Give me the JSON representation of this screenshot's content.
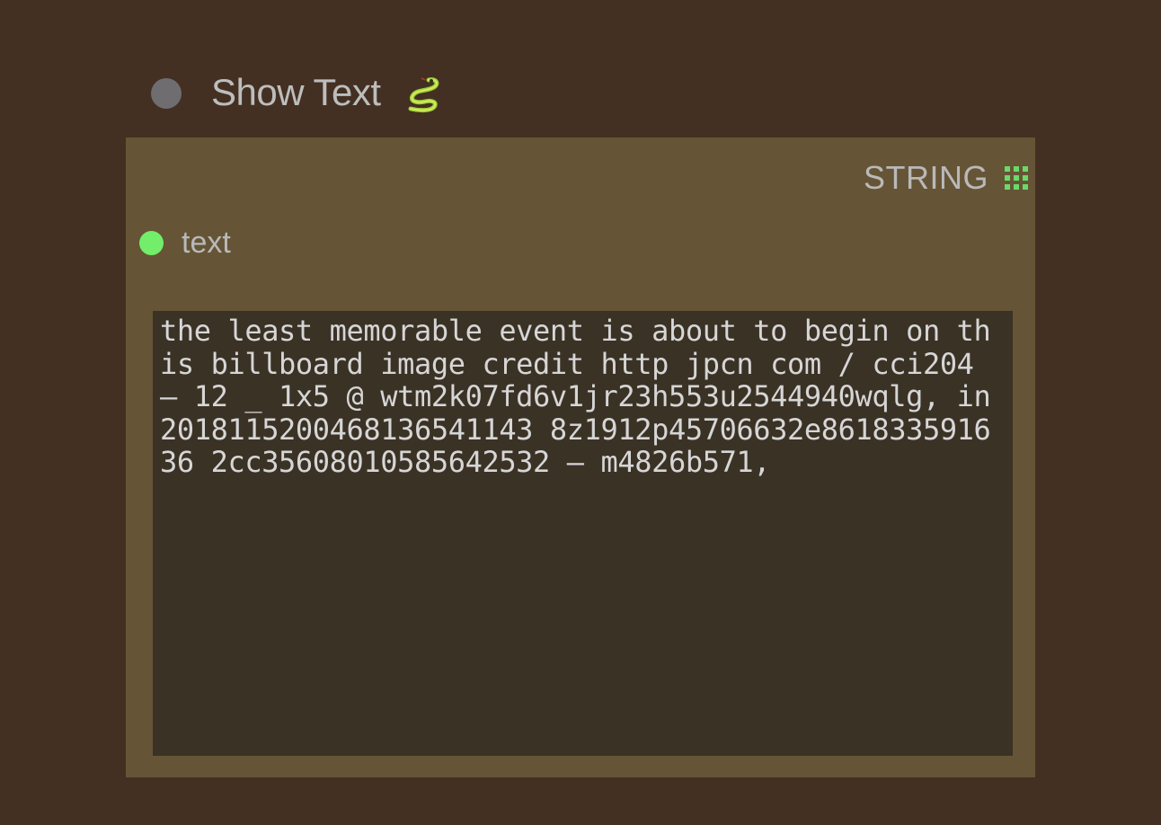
{
  "node": {
    "title": "Show Text",
    "title_icon": "snake-icon",
    "output": {
      "label": "STRING",
      "icon": "grid-icon",
      "color": "#6cd96a"
    },
    "input": {
      "label": "text",
      "color": "#72ee6a"
    },
    "text_value": "the least memorable event is about to begin on this billboard image credit http jpcn com / cci204 – 12 _ 1x5 @ wtm2k07fd6v1jr23h553u2544940wqlg, in 2018115200468136541143 8z1912p45706632e861833591636 2cc35608010585642532 – m4826b571,"
  },
  "colors": {
    "canvas": "#433022",
    "node_body": "#655536",
    "text_area": "#3b3226",
    "collapse_dot": "#6f6d6f"
  }
}
